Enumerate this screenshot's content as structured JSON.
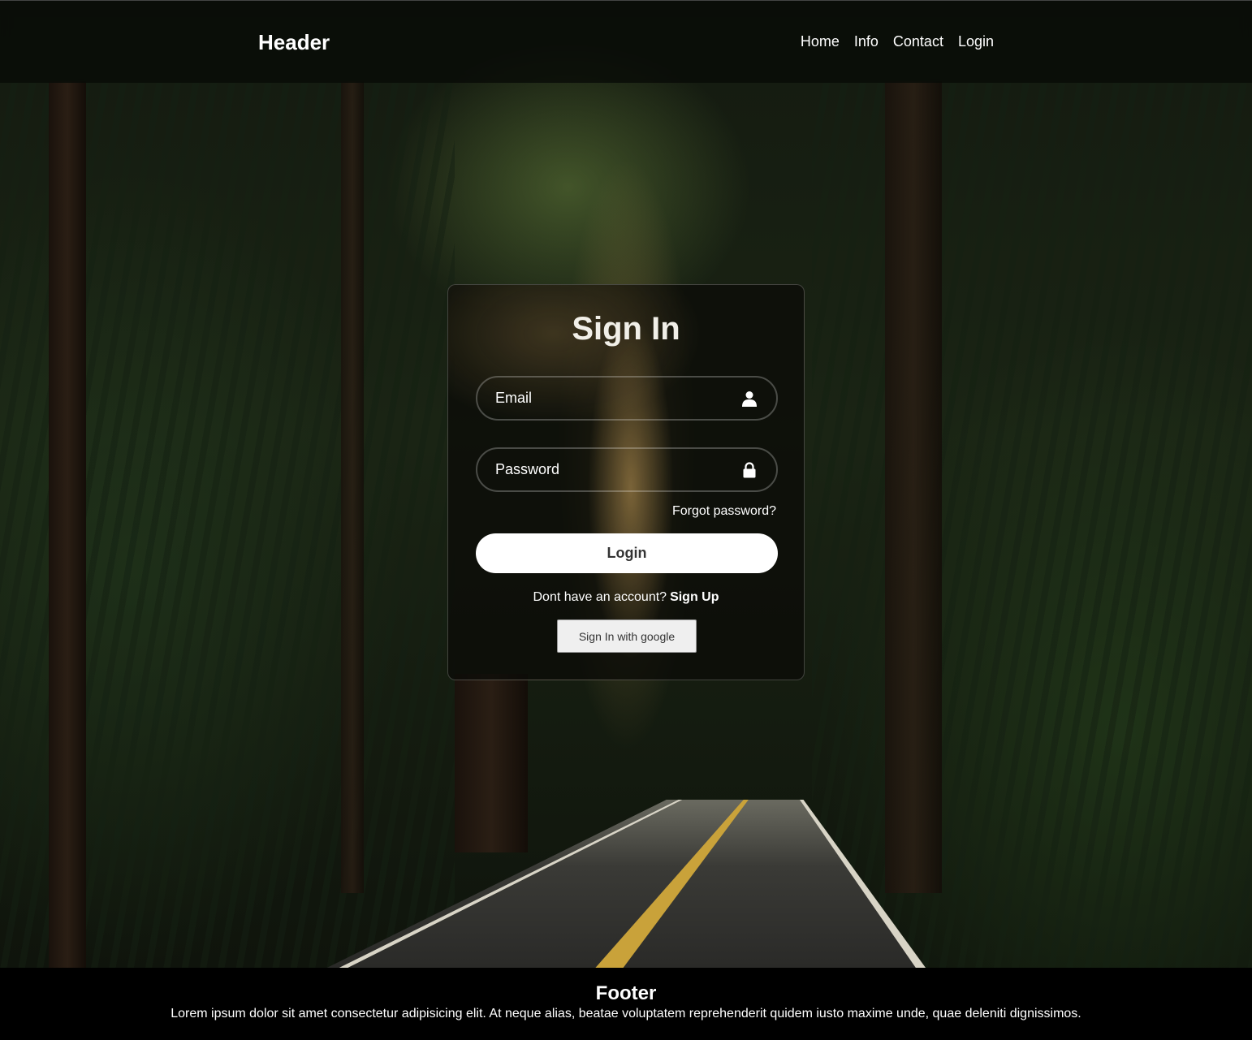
{
  "header": {
    "title": "Header",
    "nav": [
      "Home",
      "Info",
      "Contact",
      "Login"
    ]
  },
  "signin": {
    "title": "Sign In",
    "email_placeholder": "Email",
    "email_icon": "user-icon",
    "password_placeholder": "Password",
    "password_icon": "lock-icon",
    "forgot_label": "Forgot password?",
    "login_label": "Login",
    "no_account_text": "Dont have an account?",
    "signup_label": "Sign Up",
    "google_label": "Sign In with google"
  },
  "footer": {
    "title": "Footer",
    "text": "Lorem ipsum dolor sit amet consectetur adipisicing elit. At neque alias, beatae voluptatem reprehenderit quidem iusto maxime unde, quae deleniti dignissimos."
  },
  "colors": {
    "background_forest": "#1a2414",
    "card_background": "#0c0c08",
    "button_background": "#ffffff",
    "footer_background": "#000000"
  }
}
